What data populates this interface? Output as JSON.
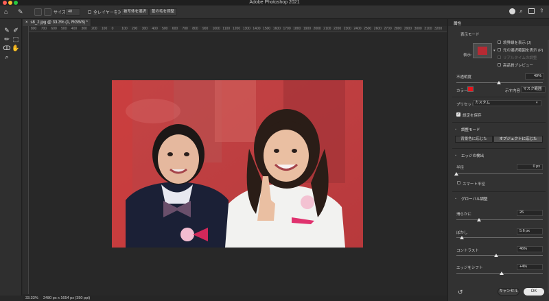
{
  "app_title": "Adobe Photoshop 2021",
  "options_bar": {
    "size_label": "サイズ",
    "size_value": "48",
    "sample_all_layers_label": "全レイヤーを対象",
    "select_subject_label": "被写体を選択",
    "refine_hair_label": "髪の毛を調整"
  },
  "document": {
    "tab_title": "s8_2.jpg @ 33.3% (1, RGB/8) *",
    "zoom": "33.33%",
    "dimensions": "2480 px x 1654 px (350 ppi)"
  },
  "ruler_marks": [
    "800",
    "700",
    "600",
    "500",
    "400",
    "300",
    "200",
    "100",
    "0",
    "100",
    "200",
    "300",
    "400",
    "500",
    "600",
    "700",
    "800",
    "900",
    "1000",
    "1100",
    "1200",
    "1300",
    "1400",
    "1500",
    "1600",
    "1700",
    "1800",
    "1900",
    "2000",
    "2100",
    "2200",
    "2300",
    "2400",
    "2500",
    "2600",
    "2700",
    "2800",
    "2900",
    "3000",
    "3100",
    "3200"
  ],
  "panel": {
    "title": "属性",
    "view_mode_label": "表示モード",
    "view_label": "表示:",
    "view_options": [
      {
        "label": "境界線を表示 (J)",
        "checked": false,
        "disabled": false
      },
      {
        "label": "元の選択範囲を表示 (P)",
        "checked": false,
        "disabled": false
      },
      {
        "label": "リアルタイムの調整",
        "checked": false,
        "disabled": true
      },
      {
        "label": "高品質プレビュー",
        "checked": false,
        "disabled": false
      }
    ],
    "opacity_label": "不透明度",
    "opacity_value": "49%",
    "opacity_fraction": 0.49,
    "color_label": "カラー:",
    "color_hex": "#e8141c",
    "display_content_label": "示す内容",
    "display_content_value": "マスク範囲",
    "preset_label": "プリセット",
    "preset_value": "カスタム",
    "remember_settings_label": "設定を保存",
    "remember_settings_checked": true,
    "adjust_mode_header": "調整モード",
    "color_aware_label": "背景色に応じた",
    "object_aware_label": "オブジェクトに応じた",
    "edge_detection_header": "エッジの検出",
    "radius_label": "半径",
    "radius_value": "0 px",
    "radius_fraction": 0.0,
    "smart_radius_label": "スマート半径",
    "global_refinements_header": "グローバル調整",
    "smooth_label": "滑らかに",
    "smooth_value": "26",
    "smooth_fraction": 0.26,
    "feather_label": "ぼかし",
    "feather_value": "5.6 px",
    "feather_fraction": 0.06,
    "contrast_label": "コントラスト",
    "contrast_value": "46%",
    "contrast_fraction": 0.46,
    "shift_edge_label": "エッジをシフト",
    "shift_edge_value": "+4%",
    "shift_edge_fraction": 0.52,
    "cancel_label": "キャンセル",
    "ok_label": "OK"
  }
}
